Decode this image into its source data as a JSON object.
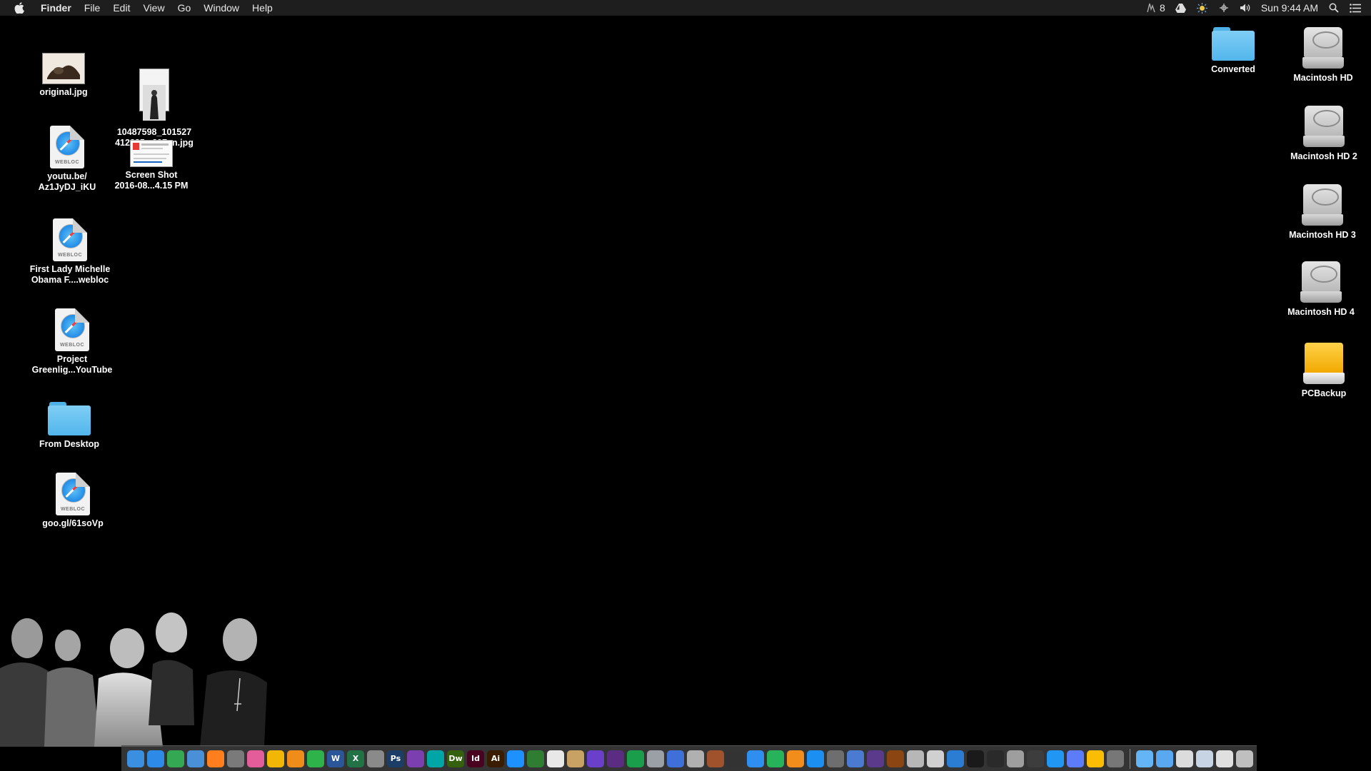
{
  "menubar": {
    "app_name": "Finder",
    "menus": [
      "File",
      "Edit",
      "View",
      "Go",
      "Window",
      "Help"
    ],
    "status_count": "8",
    "clock": "Sun 9:44 AM"
  },
  "desktop_left": [
    {
      "label": "original.jpg",
      "kind": "image"
    },
    {
      "label": "10487598_101527\n412285...397_n.jpg",
      "kind": "image"
    },
    {
      "label": "youtu.be/\nAz1JyDJ_iKU",
      "kind": "webloc"
    },
    {
      "label": "Screen Shot\n2016-08...4.15 PM",
      "kind": "image"
    },
    {
      "label": "First Lady Michelle\nObama F....webloc",
      "kind": "webloc"
    },
    {
      "label": "Project\nGreenlig...YouTube",
      "kind": "webloc"
    },
    {
      "label": "From Desktop",
      "kind": "folder"
    },
    {
      "label": "goo.gl/61soVp",
      "kind": "webloc"
    }
  ],
  "desktop_right": [
    {
      "label": "Converted",
      "kind": "folder"
    },
    {
      "label": "Macintosh HD",
      "kind": "drive"
    },
    {
      "label": "Macintosh HD 2",
      "kind": "drive"
    },
    {
      "label": "Macintosh HD 3",
      "kind": "drive"
    },
    {
      "label": "Macintosh HD 4",
      "kind": "drive"
    },
    {
      "label": "PCBackup",
      "kind": "external-drive"
    }
  ],
  "webloc_tag": "WEBLOC",
  "dock_items": [
    {
      "name": "finder-icon",
      "color": "#3b8fe0",
      "glyph": ""
    },
    {
      "name": "safari-icon",
      "color": "#2d8ae6",
      "glyph": ""
    },
    {
      "name": "chrome-icon",
      "color": "#34a853",
      "glyph": ""
    },
    {
      "name": "mail-icon",
      "color": "#4a90d9",
      "glyph": ""
    },
    {
      "name": "firefox-icon",
      "color": "#ff7f1f",
      "glyph": ""
    },
    {
      "name": "launchpad-icon",
      "color": "#7a7a7a",
      "glyph": ""
    },
    {
      "name": "itunes-icon",
      "color": "#e35d9b",
      "glyph": ""
    },
    {
      "name": "photos-icon",
      "color": "#f2b705",
      "glyph": ""
    },
    {
      "name": "pages-icon",
      "color": "#f08c1a",
      "glyph": ""
    },
    {
      "name": "numbers-icon",
      "color": "#2eb34a",
      "glyph": ""
    },
    {
      "name": "word-icon",
      "color": "#2b579a",
      "glyph": "W"
    },
    {
      "name": "excel-icon",
      "color": "#217346",
      "glyph": "X"
    },
    {
      "name": "preview-icon",
      "color": "#8a8a8a",
      "glyph": ""
    },
    {
      "name": "photoshop-icon",
      "color": "#1c3e66",
      "glyph": "Ps"
    },
    {
      "name": "affinity-icon",
      "color": "#7b3fb0",
      "glyph": ""
    },
    {
      "name": "maps-icon",
      "color": "#00a6a6",
      "glyph": ""
    },
    {
      "name": "dreamweaver-icon",
      "color": "#35600e",
      "glyph": "Dw"
    },
    {
      "name": "indesign-icon",
      "color": "#49021f",
      "glyph": "Id"
    },
    {
      "name": "illustrator-icon",
      "color": "#3a1d00",
      "glyph": "Ai"
    },
    {
      "name": "keynote-icon",
      "color": "#1e90ff",
      "glyph": ""
    },
    {
      "name": "puzzle-icon",
      "color": "#2e7d32",
      "glyph": ""
    },
    {
      "name": "textedit-icon",
      "color": "#e8e8e8",
      "glyph": ""
    },
    {
      "name": "notes-icon",
      "color": "#c8a165",
      "glyph": ""
    },
    {
      "name": "imovie-icon",
      "color": "#6a3fc9",
      "glyph": ""
    },
    {
      "name": "hd-app-icon",
      "color": "#5a2d82",
      "glyph": ""
    },
    {
      "name": "money-icon",
      "color": "#1b9e4b",
      "glyph": ""
    },
    {
      "name": "telescope-icon",
      "color": "#9aa0a6",
      "glyph": ""
    },
    {
      "name": "chat-icon",
      "color": "#3f6fd8",
      "glyph": ""
    },
    {
      "name": "script-icon",
      "color": "#b0b0b0",
      "glyph": ""
    },
    {
      "name": "tools-icon",
      "color": "#a0522d",
      "glyph": ""
    },
    {
      "name": "guitar-icon",
      "color": "#333333",
      "glyph": ""
    },
    {
      "name": "messages-icon",
      "color": "#2f8ff0",
      "glyph": ""
    },
    {
      "name": "facetime-icon",
      "color": "#26b35a",
      "glyph": ""
    },
    {
      "name": "ibooks-icon",
      "color": "#f28d1b",
      "glyph": ""
    },
    {
      "name": "app-store-icon",
      "color": "#1b8ff2",
      "glyph": ""
    },
    {
      "name": "system-prefs-icon",
      "color": "#6e6e6e",
      "glyph": ""
    },
    {
      "name": "migration-icon",
      "color": "#4a7bd0",
      "glyph": ""
    },
    {
      "name": "remote-icon",
      "color": "#5b3a8c",
      "glyph": ""
    },
    {
      "name": "gaming-icon",
      "color": "#8b4513",
      "glyph": ""
    },
    {
      "name": "installer-icon",
      "color": "#b7b7b7",
      "glyph": ""
    },
    {
      "name": "dvd-player-icon",
      "color": "#d0d0d0",
      "glyph": ""
    },
    {
      "name": "refresh-icon",
      "color": "#2b7cd3",
      "glyph": ""
    },
    {
      "name": "activity-monitor-icon",
      "color": "#1a1a1a",
      "glyph": ""
    },
    {
      "name": "console-icon",
      "color": "#2a2a2a",
      "glyph": ""
    },
    {
      "name": "archive-icon",
      "color": "#9e9e9e",
      "glyph": ""
    },
    {
      "name": "clock-icon",
      "color": "#3d3d3d",
      "glyph": ""
    },
    {
      "name": "cloud-drive-icon",
      "color": "#2196f3",
      "glyph": ""
    },
    {
      "name": "network-icon",
      "color": "#5c7cfa",
      "glyph": ""
    },
    {
      "name": "drive-app-icon",
      "color": "#fbbc04",
      "glyph": ""
    },
    {
      "name": "utility-icon",
      "color": "#777777",
      "glyph": ""
    }
  ],
  "dock_stacks": [
    {
      "name": "applications-stack-icon",
      "color": "#64b5f6"
    },
    {
      "name": "documents-stack-icon",
      "color": "#5aa9f0"
    },
    {
      "name": "downloads-stack-icon",
      "color": "#dcdcdc"
    },
    {
      "name": "screens-stack-icon",
      "color": "#c7d4e4"
    },
    {
      "name": "files-stack-icon",
      "color": "#e0e0e0"
    },
    {
      "name": "trash-icon",
      "color": "#bfbfbf"
    }
  ]
}
